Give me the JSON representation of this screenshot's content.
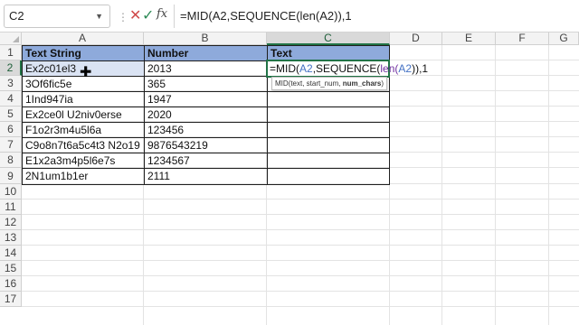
{
  "name_box": {
    "value": "C2"
  },
  "formula_bar": {
    "cancel_icon": "✕",
    "enter_icon": "✓",
    "fx_label": "fx",
    "value": "=MID(A2,SEQUENCE(len(A2)),1"
  },
  "columns": [
    "A",
    "B",
    "C",
    "D",
    "E",
    "F",
    "G"
  ],
  "rows": [
    "1",
    "2",
    "3",
    "4",
    "5",
    "6",
    "7",
    "8",
    "9",
    "10",
    "11",
    "12",
    "13",
    "14",
    "15",
    "16",
    "17"
  ],
  "headers": {
    "a1": "Text String",
    "b1": "Number",
    "c1": "Text"
  },
  "data_rows": [
    {
      "text_string": "Ex2c01el3",
      "number": "2013"
    },
    {
      "text_string": "3Of6fic5e",
      "number": "365"
    },
    {
      "text_string": "1Ind947ia",
      "number": "1947"
    },
    {
      "text_string": "Ex2ce0l U2niv0erse",
      "number": "2020"
    },
    {
      "text_string": "F1o2r3m4u5l6a",
      "number": "123456"
    },
    {
      "text_string": "C9o8n7t6a5c4t3 N2o19",
      "number": "9876543219"
    },
    {
      "text_string": "E1x2a3m4p5l6e7s",
      "number": "1234567"
    },
    {
      "text_string": "2N1um1b1er",
      "number": "2111"
    }
  ],
  "active_cell": {
    "parts": [
      "=MID(",
      "A2",
      ",SEQUENCE(",
      "len(",
      "A2",
      ")),1"
    ]
  },
  "tooltip": {
    "prefix": "MID(text, start_num, ",
    "bold": "num_chars",
    "suffix": ")"
  },
  "colors": {
    "header_fill": "#8eaadb",
    "ref_blue": "#4472c4",
    "ref_purple": "#7030a0",
    "excel_green": "#217346"
  }
}
